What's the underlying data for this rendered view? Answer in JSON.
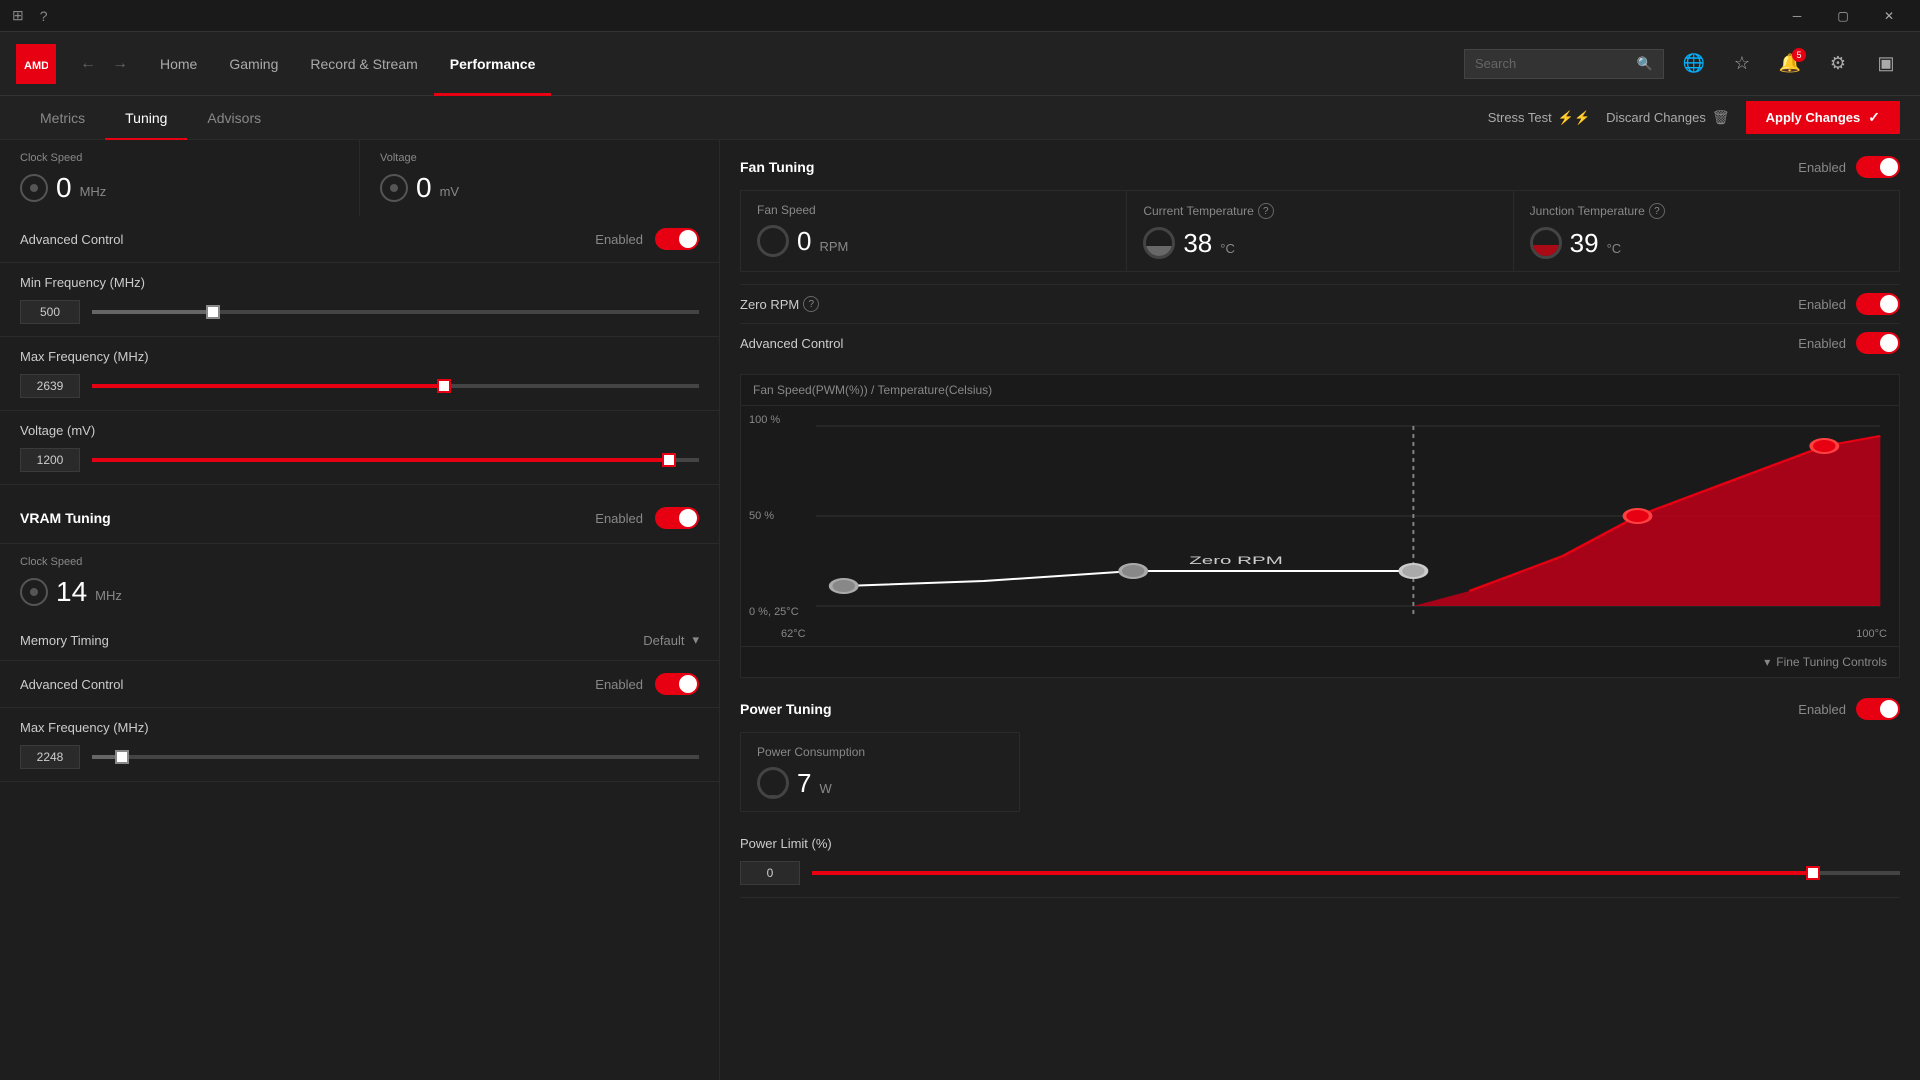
{
  "titlebar": {
    "btns": [
      "minimize",
      "maximize",
      "close"
    ]
  },
  "header": {
    "logo": "AMD",
    "nav": [
      {
        "label": "Home",
        "active": false
      },
      {
        "label": "Gaming",
        "active": false
      },
      {
        "label": "Record & Stream",
        "active": false
      },
      {
        "label": "Performance",
        "active": true
      }
    ],
    "search_placeholder": "Search",
    "notification_count": "5"
  },
  "subnav": {
    "tabs": [
      {
        "label": "Metrics",
        "active": false
      },
      {
        "label": "Tuning",
        "active": true
      },
      {
        "label": "Advisors",
        "active": false
      }
    ],
    "stress_test": "Stress Test",
    "discard": "Discard Changes",
    "apply": "Apply Changes"
  },
  "left_panel": {
    "gpu_clock": {
      "label": "Clock Speed",
      "value": "0",
      "unit": "MHz"
    },
    "gpu_voltage": {
      "label": "Voltage",
      "value": "0",
      "unit": "mV"
    },
    "advanced_control": {
      "label": "Advanced Control",
      "status": "Enabled",
      "enabled": true
    },
    "min_freq": {
      "label": "Min Frequency (MHz)",
      "value": "500",
      "percent": 20
    },
    "max_freq": {
      "label": "Max Frequency (MHz)",
      "value": "2639",
      "percent": 58
    },
    "voltage": {
      "label": "Voltage (mV)",
      "value": "1200",
      "percent": 95
    },
    "vram": {
      "title": "VRAM Tuning",
      "status": "Enabled",
      "enabled": true
    },
    "vram_clock": {
      "label": "Clock Speed",
      "value": "14",
      "unit": "MHz"
    },
    "memory_timing": {
      "label": "Memory Timing",
      "value": "Default"
    },
    "vram_advanced": {
      "label": "Advanced Control",
      "status": "Enabled",
      "enabled": true
    },
    "vram_max_freq": {
      "label": "Max Frequency (MHz)",
      "value": "2248",
      "percent": 5
    }
  },
  "right_panel": {
    "fan_tuning": {
      "title": "Fan Tuning",
      "status": "Enabled",
      "enabled": true,
      "fan_speed": {
        "label": "Fan Speed",
        "value": "0",
        "unit": "RPM"
      },
      "current_temp": {
        "label": "Current Temperature",
        "value": "38",
        "unit": "°C"
      },
      "junction_temp": {
        "label": "Junction Temperature",
        "value": "39",
        "unit": "°C"
      },
      "zero_rpm": {
        "label": "Zero RPM",
        "status": "Enabled",
        "enabled": true
      },
      "advanced": {
        "label": "Advanced Control",
        "status": "Enabled",
        "enabled": true
      },
      "chart": {
        "title": "Fan Speed(PWM(%)) / Temperature(Celsius)",
        "y_labels": [
          "100 %",
          "50 %",
          "0 %, 25°C"
        ],
        "x_labels": [
          "62°C",
          "100°C"
        ],
        "zero_rpm_label": "Zero RPM",
        "fine_tuning": "Fine Tuning Controls"
      }
    },
    "power_tuning": {
      "title": "Power Tuning",
      "status": "Enabled",
      "enabled": true,
      "consumption": {
        "label": "Power Consumption",
        "value": "7",
        "unit": "W"
      },
      "limit": {
        "label": "Power Limit (%)",
        "value": "0",
        "percent": 92
      }
    }
  }
}
